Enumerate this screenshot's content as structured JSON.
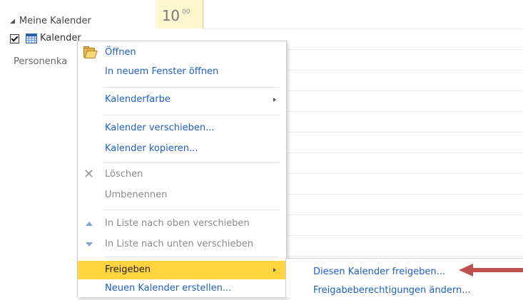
{
  "nav": {
    "group_header": "Meine Kalender",
    "calendar_item_label": "Kalender",
    "section_header": "Personenka"
  },
  "calendar_grid": {
    "time_hour": "10",
    "time_minutes": "00"
  },
  "context_menu": {
    "items": [
      {
        "label": "Öffnen",
        "enabled": true,
        "icon": "open-folder-icon"
      },
      {
        "label": "In neuem Fenster öffnen",
        "enabled": true
      },
      {
        "label": "Kalenderfarbe",
        "enabled": true,
        "submenu": true
      },
      {
        "label": "Kalender verschieben...",
        "enabled": false
      },
      {
        "label": "Kalender kopieren...",
        "enabled": true
      },
      {
        "label": "Löschen",
        "enabled": false,
        "icon": "delete-x-icon"
      },
      {
        "label": "Umbenennen",
        "enabled": false
      },
      {
        "label": "In Liste nach oben verschieben",
        "enabled": false,
        "icon": "move-up-icon"
      },
      {
        "label": "In Liste nach unten verschieben",
        "enabled": false,
        "icon": "move-down-icon"
      },
      {
        "label": "Freigeben",
        "enabled": true,
        "highlighted": true,
        "submenu": true
      },
      {
        "label": "Neuen Kalender erstellen...",
        "enabled": true
      }
    ]
  },
  "share_submenu": {
    "items": [
      {
        "label": "Diesen Kalender freigeben..."
      },
      {
        "label": "Freigabeberechtigungen ändern..."
      }
    ]
  },
  "colors": {
    "link_blue": "#1f5fbf",
    "disabled_gray": "#8a8a8a",
    "highlight_yellow": "#ffd43f",
    "annotation_red": "#c0504d",
    "current_time_bg": "#fdf6cf"
  }
}
